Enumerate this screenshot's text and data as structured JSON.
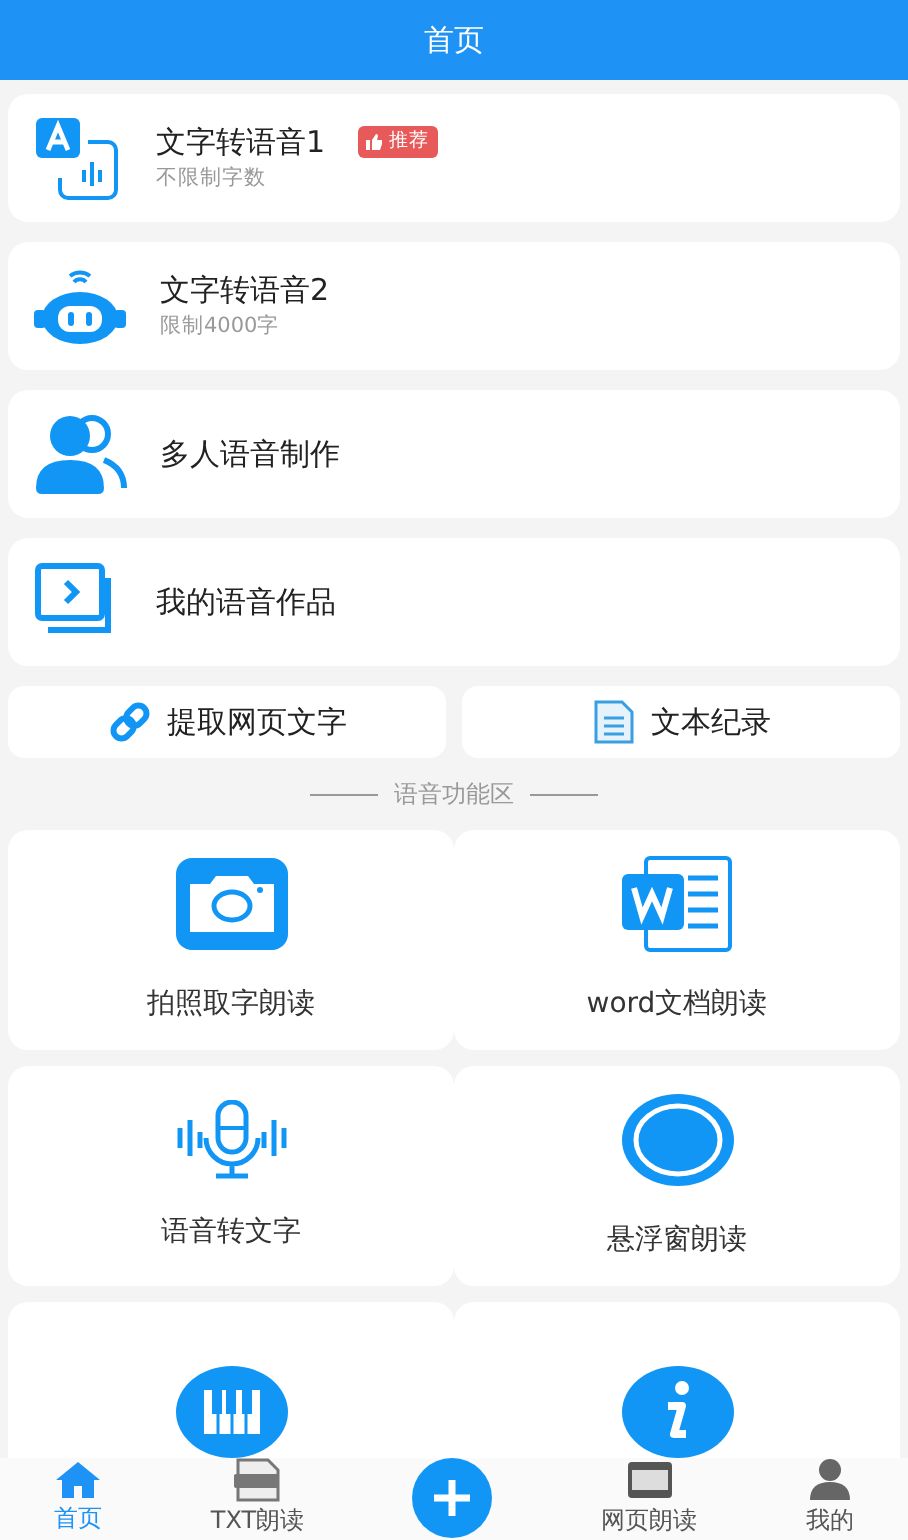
{
  "header": {
    "title": "首页"
  },
  "features": [
    {
      "kind": "tts",
      "title": "文字转语音1",
      "subtitle": "不限制字数",
      "badge": "推荐"
    },
    {
      "kind": "robot",
      "title": "文字转语音2",
      "subtitle": "限制4000字"
    },
    {
      "kind": "people",
      "title": "多人语音制作"
    },
    {
      "kind": "works",
      "title": "我的语音作品"
    }
  ],
  "quick_buttons": [
    {
      "kind": "link",
      "label": "提取网页文字"
    },
    {
      "kind": "doc",
      "label": "文本纪录"
    }
  ],
  "section_title": "语音功能区",
  "tiles": [
    {
      "kind": "camera",
      "label": "拍照取字朗读"
    },
    {
      "kind": "word",
      "label": "word文档朗读"
    },
    {
      "kind": "mic",
      "label": "语音转文字"
    },
    {
      "kind": "float",
      "label": "悬浮窗朗读"
    },
    {
      "kind": "piano"
    },
    {
      "kind": "info"
    }
  ],
  "bottom_nav": [
    {
      "kind": "home",
      "label": "首页",
      "selected": true
    },
    {
      "kind": "txt",
      "label": "TXT朗读",
      "selected": false
    },
    {
      "kind": "plus",
      "selected": false
    },
    {
      "kind": "web",
      "label": "网页朗读",
      "selected": false
    },
    {
      "kind": "user",
      "label": "我的",
      "selected": false
    }
  ]
}
